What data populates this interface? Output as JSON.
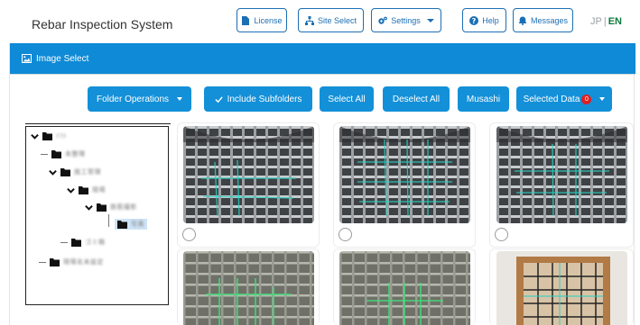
{
  "header": {
    "app_title": "Rebar Inspection System",
    "buttons": {
      "license": "License",
      "site_select": "Site Select",
      "settings": "Settings",
      "help": "Help",
      "messages": "Messages"
    },
    "lang": {
      "jp": "JP",
      "separator": "|",
      "en": "EN"
    }
  },
  "card": {
    "title": "Image Select"
  },
  "toolbar": {
    "folder_operations": "Folder Operations",
    "include_subfolders": "Include Subfolders",
    "select_all": "Select All",
    "deselect_all": "Deselect All",
    "musashi": "Musashi",
    "selected_data": "Selected Data",
    "selected_count": "0"
  },
  "tree": {
    "nodes": [
      {
        "label": "ｿﾌﾄ"
      },
      {
        "label": "未整理"
      },
      {
        "label": "施工管理"
      },
      {
        "label": "現場"
      },
      {
        "label": "鉄筋撮影"
      },
      {
        "label": "写真"
      },
      {
        "label": "ゴミ箱"
      },
      {
        "label": "現場名未設定"
      }
    ]
  },
  "colors": {
    "primary": "#1390d8",
    "header_bar": "#0f8ad6",
    "outline": "#1c6fb4",
    "lang_active": "#0d7a3e",
    "badge": "#e02020"
  }
}
